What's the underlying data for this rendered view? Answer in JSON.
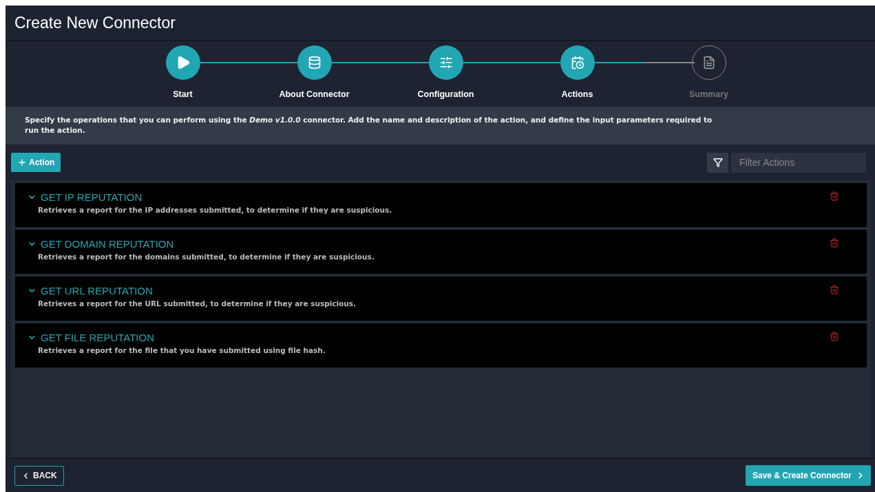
{
  "window": {
    "title": "Create New Connector"
  },
  "steps": [
    {
      "label": "Start",
      "kind": "start",
      "done": true
    },
    {
      "label": "About Connector",
      "kind": "about",
      "done": true
    },
    {
      "label": "Configuration",
      "kind": "config",
      "done": true
    },
    {
      "label": "Actions",
      "kind": "actions",
      "done": true
    },
    {
      "label": "Summary",
      "kind": "summary",
      "done": false
    }
  ],
  "info": "Specify the operations that you can perform using the *Demo  v1.0.0* connector. Add the name and description of the action, and define the input parameters required to run the action.",
  "add_button": "Action",
  "filter": {
    "placeholder": "Filter Actions"
  },
  "actions": [
    {
      "name": "GET IP REPUTATION",
      "description": "Retrieves a report for the IP addresses submitted, to determine if they are suspicious.",
      "expanded": true
    },
    {
      "name": "GET DOMAIN REPUTATION",
      "description": "Retrieves a report for the domains submitted, to determine if they are suspicious.",
      "expanded": true
    },
    {
      "name": "GET URL REPUTATION",
      "description": "Retrieves a report for the URL submitted, to determine if they are suspicious.",
      "expanded": true
    },
    {
      "name": "GET FILE REPUTATION",
      "description": "Retrieves a report for the file that you have submitted using file hash.",
      "expanded": true
    }
  ],
  "footer": {
    "back": "BACK",
    "save": "Save & Create Connector"
  }
}
